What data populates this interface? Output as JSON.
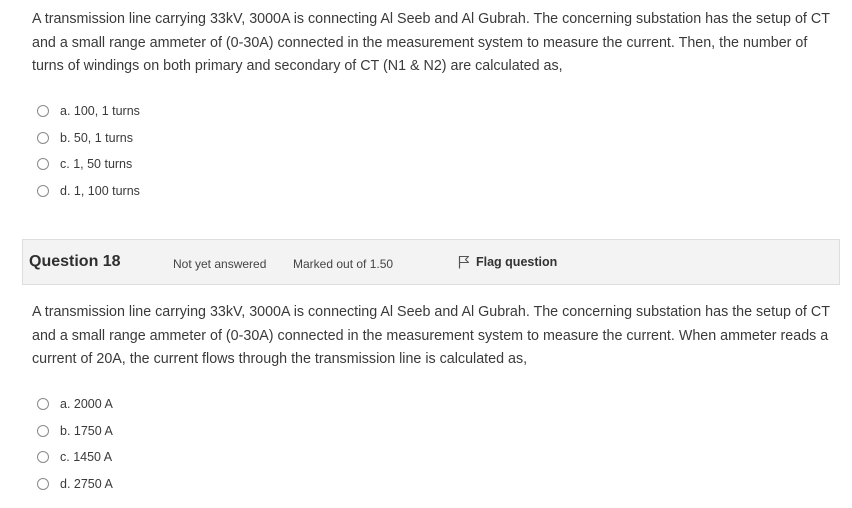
{
  "question_prev": {
    "text": "A transmission line carrying 33kV, 3000A is connecting Al Seeb and Al Gubrah. The concerning substation has the setup of CT and a small range ammeter of (0-30A) connected in the measurement system to measure the current. Then, the number of turns of windings on both primary and secondary of CT (N1 & N2) are calculated as,",
    "options": [
      {
        "label": "a. 100, 1 turns"
      },
      {
        "label": "b. 50, 1 turns"
      },
      {
        "label": "c. 1, 50 turns"
      },
      {
        "label": "d. 1, 100 turns"
      }
    ]
  },
  "question_18": {
    "header": {
      "number_label": "Question 18",
      "state": "Not yet answered",
      "grade": "Marked out of 1.50",
      "flag_label": "Flag question",
      "flag_icon": "flag-icon"
    },
    "text": "A transmission line carrying 33kV, 3000A is connecting Al Seeb and Al Gubrah. The concerning substation has the setup of CT and a small range ammeter of (0-30A) connected in the measurement system to measure the current. When ammeter reads a current of 20A, the current flows through the transmission line is calculated as,",
    "options": [
      {
        "label": "a. 2000 A"
      },
      {
        "label": "b. 1750 A"
      },
      {
        "label": "c. 1450 A"
      },
      {
        "label": "d. 2750 A"
      }
    ]
  },
  "colors": {
    "header_background": "#f3f3f3",
    "header_border": "#dedede",
    "text": "#3a3a3a"
  }
}
